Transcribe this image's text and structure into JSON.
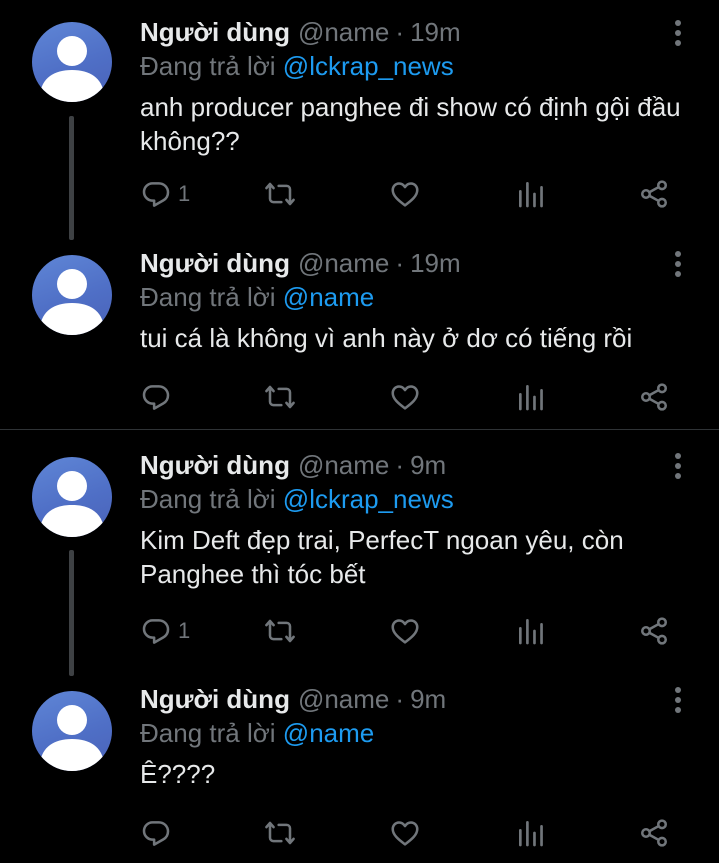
{
  "tweets": [
    {
      "display_name": "Người dùng",
      "handle": "@name",
      "separator": "·",
      "time": "19m",
      "replying_prefix": "Đang trả lời",
      "replying_to": "@lckrap_news",
      "text": "anh producer panghee đi show có định gội đầu không??",
      "reply_count": "1"
    },
    {
      "display_name": "Người dùng",
      "handle": "@name",
      "separator": "·",
      "time": "19m",
      "replying_prefix": "Đang trả lời",
      "replying_to": "@name",
      "text": "tui cá là không vì anh này ở dơ có tiếng rồi",
      "reply_count": ""
    },
    {
      "display_name": "Người dùng",
      "handle": "@name",
      "separator": "·",
      "time": "9m",
      "replying_prefix": "Đang trả lời",
      "replying_to": "@lckrap_news",
      "text": "Kim Deft đẹp trai, PerfecT ngoan yêu, còn Panghee thì tóc bết",
      "reply_count": "1"
    },
    {
      "display_name": "Người dùng",
      "handle": "@name",
      "separator": "·",
      "time": "9m",
      "replying_prefix": "Đang trả lời",
      "replying_to": "@name",
      "text": "Ê????",
      "reply_count": ""
    }
  ],
  "icons": {
    "reply": "reply-icon",
    "retweet": "retweet-icon",
    "like": "like-icon",
    "views": "views-icon",
    "share": "share-icon",
    "more": "more-icon",
    "avatar": "default-avatar-icon"
  },
  "colors": {
    "background": "#000000",
    "text": "#e7e9ea",
    "muted": "#71767b",
    "mention": "#1d9bf0",
    "avatar": "#5577cc"
  }
}
